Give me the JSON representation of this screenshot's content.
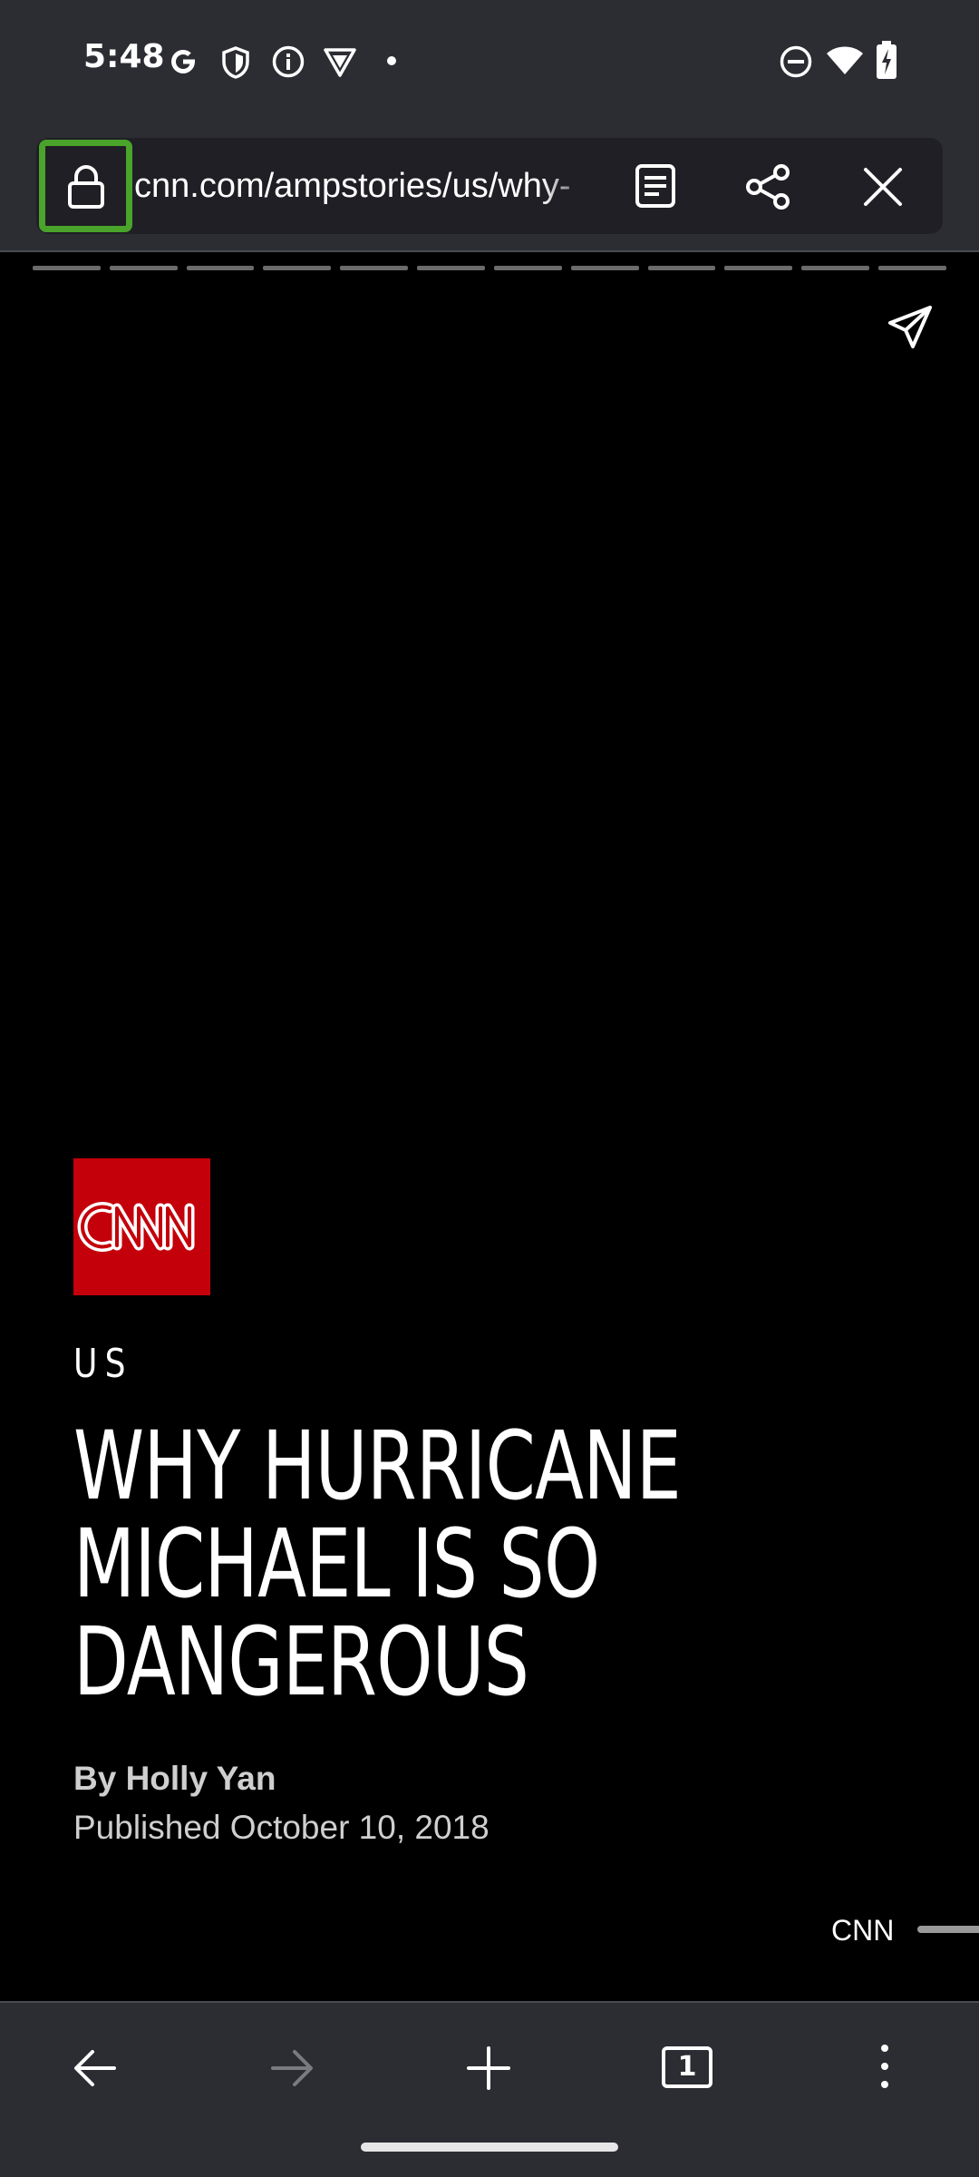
{
  "status_bar": {
    "time": "5:48",
    "icons": [
      "google-icon",
      "shield-icon",
      "info-icon",
      "vpn-icon",
      "notification-dot-icon",
      "do-not-disturb-icon",
      "wifi-icon",
      "battery-charging-icon"
    ]
  },
  "browser": {
    "url": "cnn.com/ampstories/us/why-",
    "actions": [
      "reader-mode-icon",
      "share-icon",
      "close-icon"
    ]
  },
  "story": {
    "progress_segments": 12,
    "section": "US",
    "headline_lines": [
      "WHY HURRICANE",
      "MICHAEL IS SO",
      "DANGEROUS"
    ],
    "byline": "By Holly Yan",
    "published": "Published October 10, 2018",
    "attribution": "CNN",
    "logo_text": "CNN",
    "brand_color": "#c4000a"
  },
  "bottom_nav": {
    "tab_count": "1",
    "items": [
      "back-icon",
      "forward-icon",
      "new-tab-icon",
      "tab-switcher-icon",
      "more-menu-icon"
    ]
  },
  "colors": {
    "chrome_background": "#2c2c33",
    "lock_highlight": "#4aa32a",
    "story_background": "#000000"
  }
}
